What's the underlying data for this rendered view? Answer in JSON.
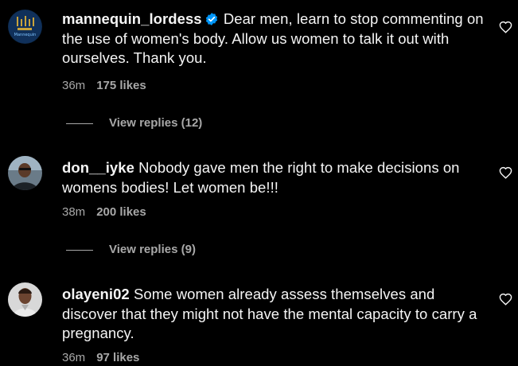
{
  "comments": [
    {
      "username": "mannequin_lordess",
      "verified": true,
      "text": "Dear men, learn to stop commenting on the use of women's body. Allow us women to talk it out with ourselves. Thank you.",
      "time": "36m",
      "likes": "175 likes",
      "replies": "View replies (12)",
      "avatar_icon": "mannequin-brand-logo",
      "avatar_text": "Mannequin"
    },
    {
      "username": "don__iyke",
      "verified": false,
      "text": "Nobody gave men the right to make decisions on womens bodies! Let women be!!!",
      "time": "38m",
      "likes": "200 likes",
      "replies": "View replies (9)",
      "avatar_icon": "user-photo"
    },
    {
      "username": "olayeni02",
      "verified": false,
      "text": "Some women already assess themselves and discover that they might not have the mental capacity to carry a pregnancy.",
      "time": "36m",
      "likes": "97 likes",
      "avatar_icon": "user-photo"
    }
  ],
  "colors": {
    "background": "#000000",
    "text": "#f5f5f5",
    "secondary": "#a8a8a8",
    "verified_badge": "#0095f6"
  },
  "icons": {
    "like": "heart-outline-icon",
    "verified": "verified-badge-icon"
  }
}
